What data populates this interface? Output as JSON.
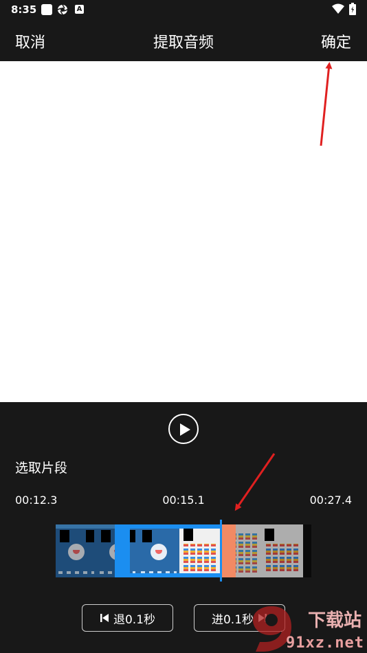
{
  "status_bar": {
    "time": "8:35",
    "badge": "A"
  },
  "toolbar": {
    "cancel_label": "取消",
    "title": "提取音频",
    "confirm_label": "确定"
  },
  "clip": {
    "section_label": "选取片段",
    "start_time": "00:12.3",
    "current_time": "00:15.1",
    "end_time": "00:27.4"
  },
  "controls": {
    "back_label": "退0.1秒",
    "forward_label": "进0.1秒"
  },
  "watermark": {
    "site": "91xz.net",
    "cn": "下载站"
  },
  "colors": {
    "background": "#181818",
    "selection": "#1b8ef0",
    "selection_handle": "#f28a64",
    "annotation": "#e02020"
  }
}
